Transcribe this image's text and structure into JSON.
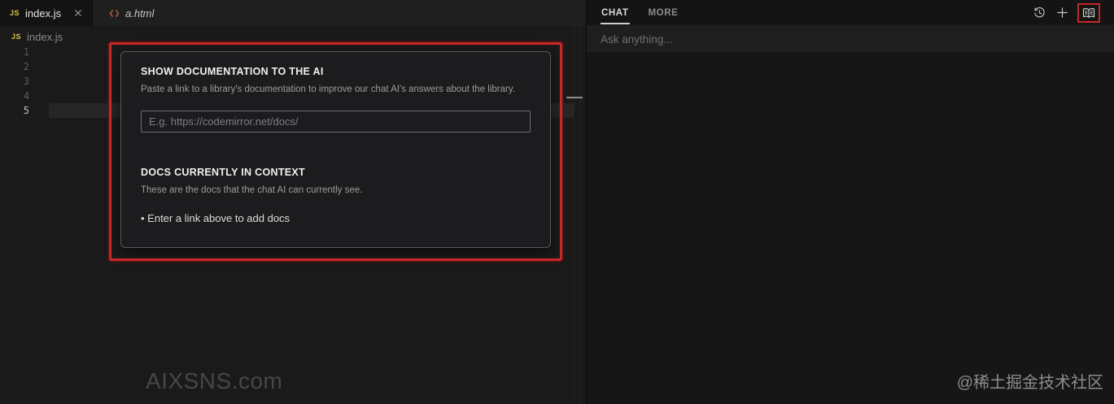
{
  "editor": {
    "tabs": [
      {
        "label": "index.js",
        "icon": "javascript-icon",
        "icon_text": "JS",
        "state": "active"
      },
      {
        "label": "a.html",
        "icon": "html-code-icon",
        "state": "preview"
      }
    ],
    "breadcrumb": {
      "icon": "javascript-icon",
      "icon_text": "JS",
      "label": "index.js"
    },
    "line_numbers": [
      "1",
      "2",
      "3",
      "4",
      "5"
    ],
    "active_line": "5",
    "watermark": "AIXSNS.com"
  },
  "docs_modal": {
    "section1": {
      "title": "SHOW DOCUMENTATION TO THE AI",
      "description": "Paste a link to a library's documentation to improve our chat AI's answers about the library.",
      "input_value": "",
      "input_placeholder": "E.g. https://codemirror.net/docs/"
    },
    "section2": {
      "title": "DOCS CURRENTLY IN CONTEXT",
      "description": "These are the docs that the chat AI can currently see.",
      "empty_item": "• Enter a link above to add docs"
    }
  },
  "chat": {
    "tabs": [
      {
        "label": "CHAT",
        "state": "active"
      },
      {
        "label": "MORE",
        "state": "inactive"
      }
    ],
    "icons": [
      "history-icon",
      "new-chat-icon",
      "open-book-docs-icon"
    ],
    "input_value": "",
    "input_placeholder": "Ask anything...",
    "watermark": "@稀土掘金技术社区"
  },
  "annotation": {
    "color": "#c32a27",
    "highlighted_regions": [
      "docs-modal",
      "open-book-docs-icon"
    ]
  }
}
